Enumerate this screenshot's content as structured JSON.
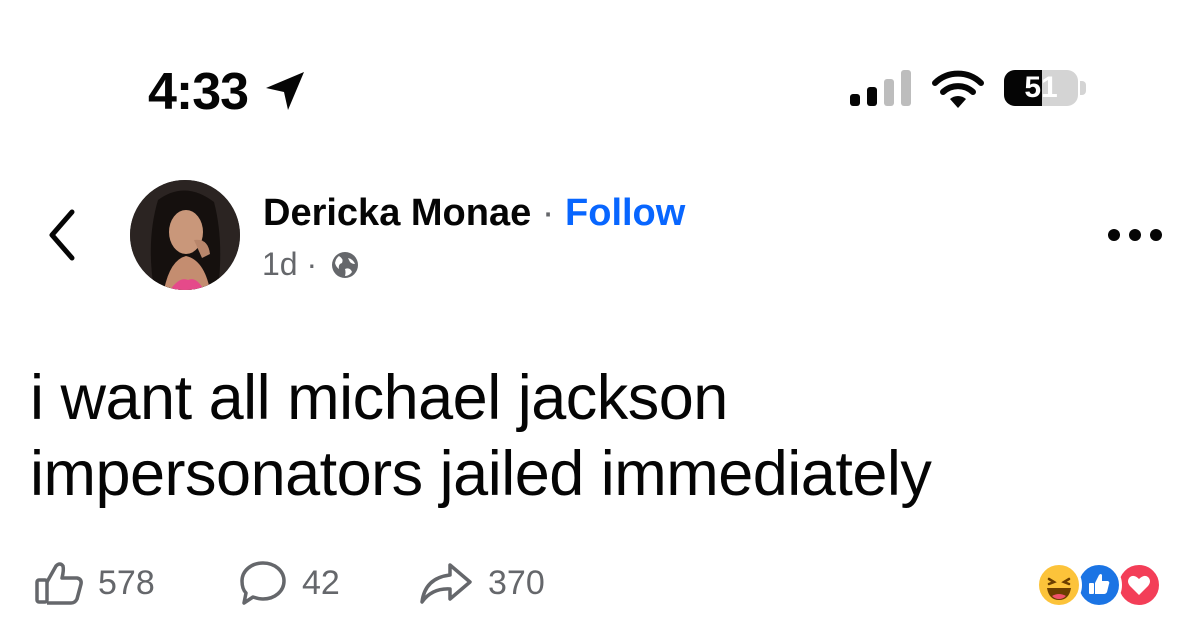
{
  "status_bar": {
    "time": "4:33",
    "battery": "51",
    "battery_level": 0.51,
    "icons": [
      "location-arrow-icon",
      "cellular-signal-icon",
      "wifi-icon",
      "battery-icon"
    ]
  },
  "post": {
    "author": "Dericka Monae",
    "separator": "·",
    "follow_label": "Follow",
    "age": "1d",
    "meta_separator": "·",
    "audience_icon": "globe-icon",
    "text_lines": [
      "i want all michael jackson",
      "impersonators jailed immediately"
    ]
  },
  "footer": {
    "likes": "578",
    "comments": "42",
    "shares": "370",
    "reaction_icons": [
      "haha-icon",
      "like-icon",
      "love-icon"
    ]
  },
  "colors": {
    "follow_blue": "#0866ff",
    "meta_gray": "#65676b",
    "like_blue": "#1b74e4",
    "love_red": "#f33e58",
    "haha_yellow": "#fcc33a"
  }
}
